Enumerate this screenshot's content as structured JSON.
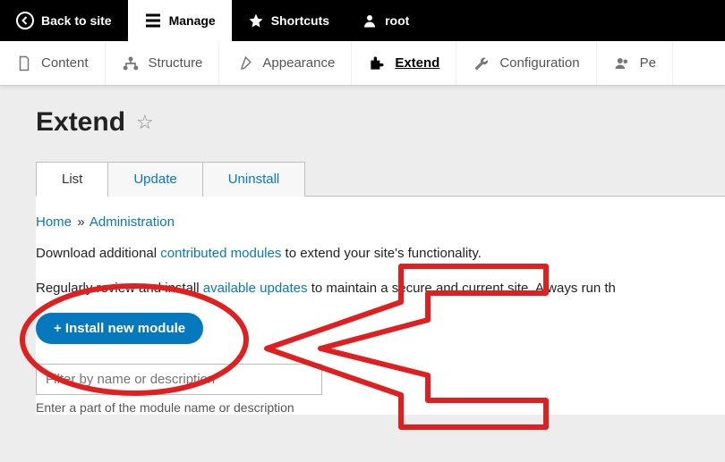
{
  "toolbar": {
    "back": "Back to site",
    "manage": "Manage",
    "shortcuts": "Shortcuts",
    "user": "root"
  },
  "admin_menu": {
    "content": "Content",
    "structure": "Structure",
    "appearance": "Appearance",
    "extend": "Extend",
    "configuration": "Configuration",
    "people": "Pe"
  },
  "page": {
    "title": "Extend"
  },
  "tabs": {
    "list": "List",
    "update": "Update",
    "uninstall": "Uninstall"
  },
  "breadcrumb": {
    "home": "Home",
    "sep": "»",
    "admin": "Administration"
  },
  "body": {
    "p1_a": "Download additional ",
    "p1_link": "contributed modules",
    "p1_b": " to extend your site's functionality.",
    "p2_a": "Regularly review and install ",
    "p2_link": "available updates",
    "p2_b": " to maintain a secure and current site. Always run th"
  },
  "install_button": "+ Install new module",
  "filter": {
    "placeholder": "Filter by name or description",
    "help": "Enter a part of the module name or description"
  }
}
